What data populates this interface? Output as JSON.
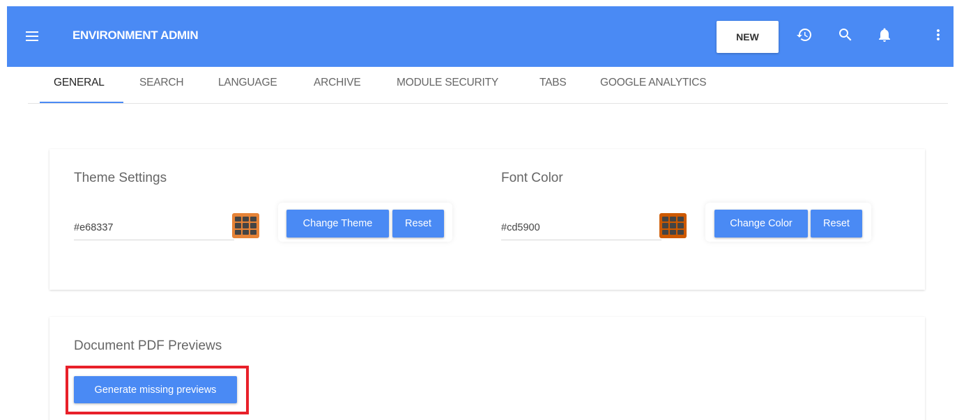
{
  "header": {
    "title": "ENVIRONMENT ADMIN",
    "new_label": "NEW",
    "icons": [
      "menu-icon",
      "history-icon",
      "search-icon",
      "bell-icon",
      "more-vert-icon"
    ]
  },
  "tabs": [
    {
      "label": "GENERAL",
      "active": true
    },
    {
      "label": "SEARCH",
      "active": false
    },
    {
      "label": "LANGUAGE",
      "active": false
    },
    {
      "label": "ARCHIVE",
      "active": false
    },
    {
      "label": "MODULE SECURITY",
      "active": false
    },
    {
      "label": "TABS",
      "active": false
    },
    {
      "label": "GOOGLE ANALYTICS",
      "active": false
    }
  ],
  "theme": {
    "title": "Theme Settings",
    "value": "#e68337",
    "swatch_color": "#e68337",
    "change_label": "Change Theme",
    "reset_label": "Reset"
  },
  "font": {
    "title": "Font Color",
    "value": "#cd5900",
    "swatch_color": "#cd5900",
    "change_label": "Change Color",
    "reset_label": "Reset"
  },
  "pdf": {
    "title": "Document PDF Previews",
    "button_label": "Generate missing previews"
  },
  "colors": {
    "accent": "#4a8af4",
    "highlight": "#e8202a"
  }
}
